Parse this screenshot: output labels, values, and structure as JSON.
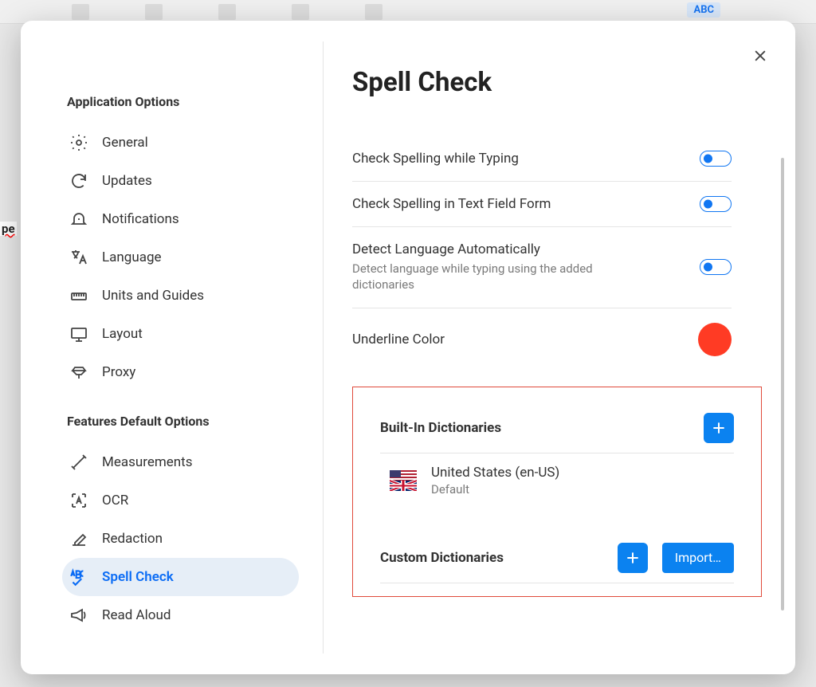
{
  "background": {
    "partial_word": "pe",
    "toolbar_abc": "ABC"
  },
  "dialog": {
    "title": "Spell Check",
    "sidebar": {
      "section_app": "Application Options",
      "section_features": "Features Default Options",
      "items_app": [
        {
          "label": "General"
        },
        {
          "label": "Updates"
        },
        {
          "label": "Notifications"
        },
        {
          "label": "Language"
        },
        {
          "label": "Units and Guides"
        },
        {
          "label": "Layout"
        },
        {
          "label": "Proxy"
        }
      ],
      "items_features": [
        {
          "label": "Measurements"
        },
        {
          "label": "OCR"
        },
        {
          "label": "Redaction"
        },
        {
          "label": "Spell Check"
        },
        {
          "label": "Read Aloud"
        }
      ]
    },
    "options": {
      "check_typing": "Check Spelling while Typing",
      "check_form": "Check Spelling in Text Field Form",
      "detect_lang": "Detect Language Automatically",
      "detect_lang_sub": "Detect language while typing using the added dictionaries",
      "underline_color": "Underline Color",
      "underline_hex": "#ff3b24"
    },
    "builtin": {
      "heading": "Built-In Dictionaries",
      "entry_name": "United States (en-US)",
      "entry_sub": "Default"
    },
    "custom": {
      "heading": "Custom Dictionaries",
      "import_label": "Import…"
    }
  }
}
